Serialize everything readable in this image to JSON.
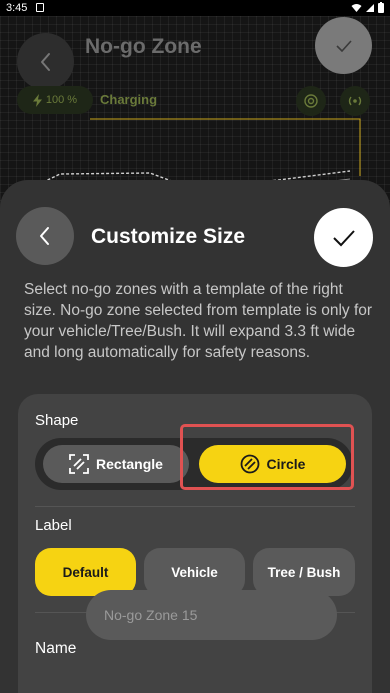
{
  "status_bar": {
    "time": "3:45"
  },
  "background": {
    "title": "No-go Zone",
    "battery": "100 %",
    "charging": "Charging"
  },
  "sheet": {
    "title": "Customize Size",
    "description": "Select no-go zones with a template of the right size. No-go zone selected from template is only for your vehicle/Tree/Bush. It will expand 3.3 ft wide and long automatically for safety reasons.",
    "shape": {
      "label": "Shape",
      "options": [
        "Rectangle",
        "Circle"
      ],
      "selected": "Circle"
    },
    "label_section": {
      "label": "Label",
      "options": [
        "Default",
        "Vehicle",
        "Tree / Bush"
      ],
      "selected": "Default"
    },
    "name": {
      "label": "Name",
      "placeholder": "No-go Zone 15",
      "value": ""
    }
  },
  "colors": {
    "accent": "#f6d312",
    "sheet_bg": "#333333",
    "card_bg": "#434343",
    "highlight": "#e05252"
  }
}
